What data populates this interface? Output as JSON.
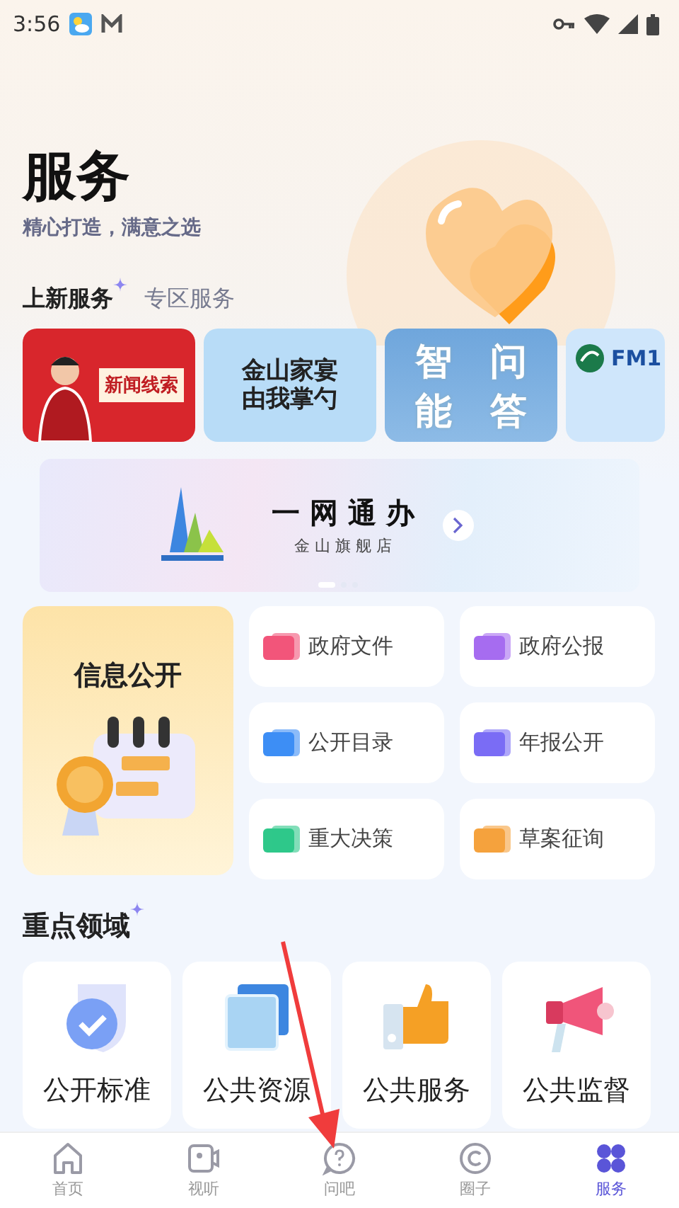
{
  "status_bar": {
    "time": "3:56"
  },
  "header": {
    "title": "服务",
    "subtitle": "精心打造，满意之选"
  },
  "tabs": [
    {
      "label": "上新服务",
      "selected": true
    },
    {
      "label": "专区服务",
      "selected": false
    }
  ],
  "tiles": [
    {
      "kind": "news",
      "lines": [
        "新闻线索"
      ]
    },
    {
      "kind": "feast",
      "lines": [
        "金山家宴",
        "由我掌勺"
      ]
    },
    {
      "kind": "qa",
      "lines": [
        "智",
        "能",
        "问",
        "答"
      ]
    },
    {
      "kind": "radio",
      "lines": [
        "FM1"
      ]
    }
  ],
  "banner": {
    "title": "一 网 通 办",
    "subtitle": "金 山 旗 舰 店"
  },
  "info_section": {
    "title": "信息公开",
    "items": [
      {
        "label": "政府文件",
        "color": "#f2557a"
      },
      {
        "label": "政府公报",
        "color": "#a66cf0"
      },
      {
        "label": "公开目录",
        "color": "#3d8ef5"
      },
      {
        "label": "年报公开",
        "color": "#7a6cf5"
      },
      {
        "label": "重大决策",
        "color": "#2fc88a"
      },
      {
        "label": "草案征询",
        "color": "#f5a23d"
      }
    ]
  },
  "focus_section": {
    "title": "重点领域",
    "items": [
      {
        "kind": "shield",
        "label": "公开标准"
      },
      {
        "kind": "layers",
        "label": "公共资源"
      },
      {
        "kind": "thumb",
        "label": "公共服务"
      },
      {
        "kind": "megaphone",
        "label": "公共监督"
      }
    ]
  },
  "nav": [
    {
      "kind": "home",
      "label": "首页",
      "selected": false
    },
    {
      "kind": "video",
      "label": "视听",
      "selected": false
    },
    {
      "kind": "question",
      "label": "问吧",
      "selected": false
    },
    {
      "kind": "circle",
      "label": "圈子",
      "selected": false
    },
    {
      "kind": "grid",
      "label": "服务",
      "selected": true
    }
  ]
}
